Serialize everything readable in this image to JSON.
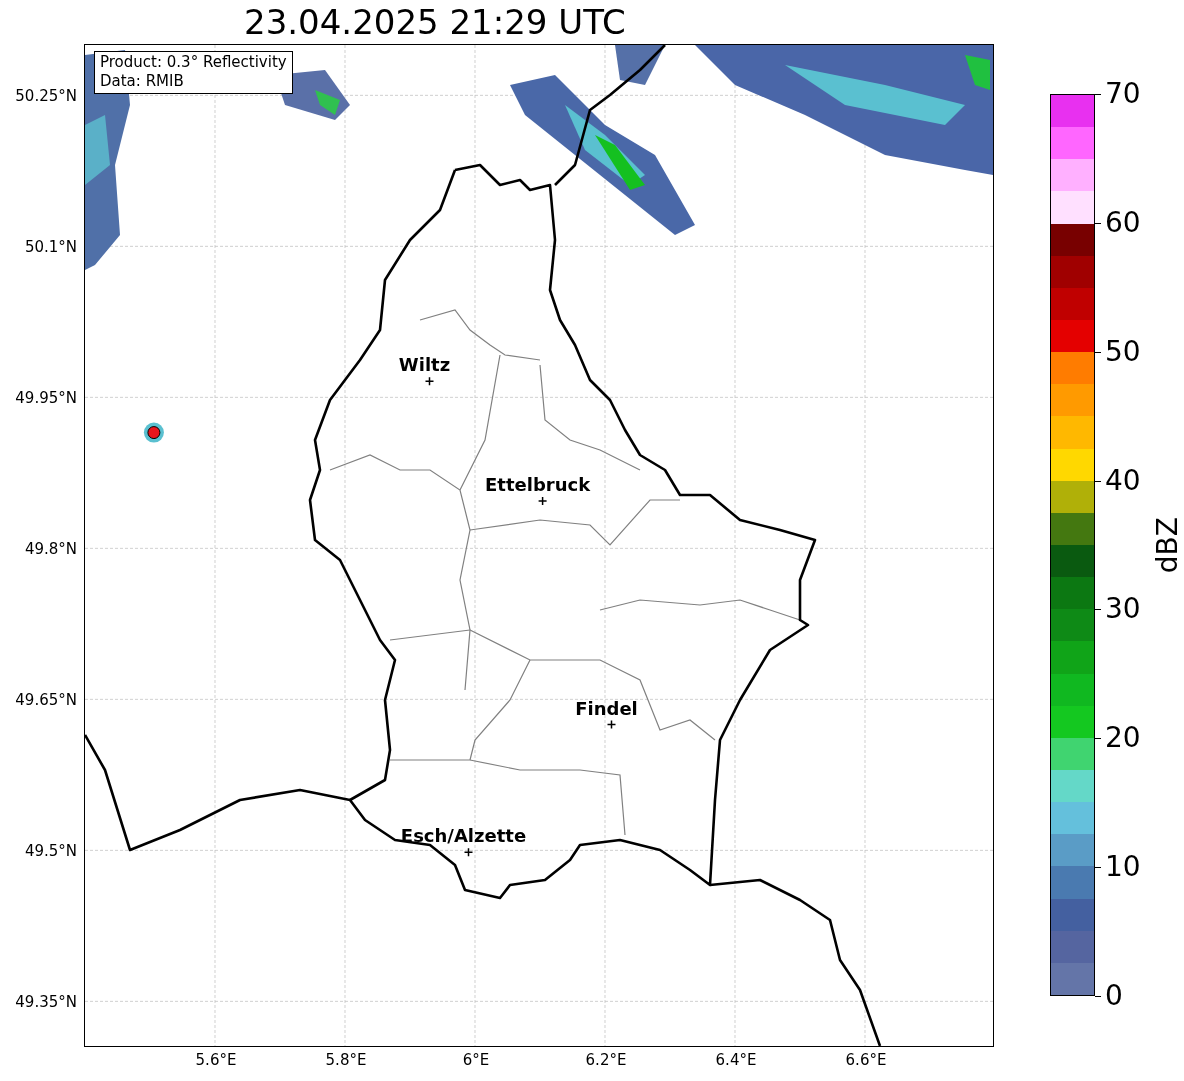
{
  "title": "23.04.2025 21:29 UTC",
  "map": {
    "info_box": [
      "Product: 0.3° Reflectivity",
      "Data: RMIB"
    ],
    "xticks": [
      "5.6°E",
      "5.8°E",
      "6°E",
      "6.2°E",
      "6.4°E",
      "6.6°E"
    ],
    "yticks": [
      "50.25°N",
      "50.1°N",
      "49.95°N",
      "49.8°N",
      "49.65°N",
      "49.5°N",
      "49.35°N"
    ],
    "places": [
      "Wiltz",
      "Ettelbruck",
      "Findel",
      "Esch/Alzette"
    ],
    "radar_site": {
      "color": "#e8141c"
    }
  },
  "colorbar": {
    "label": "dBZ",
    "ticks": [
      "70",
      "60",
      "50",
      "40",
      "30",
      "20",
      "10",
      "0"
    ]
  }
}
